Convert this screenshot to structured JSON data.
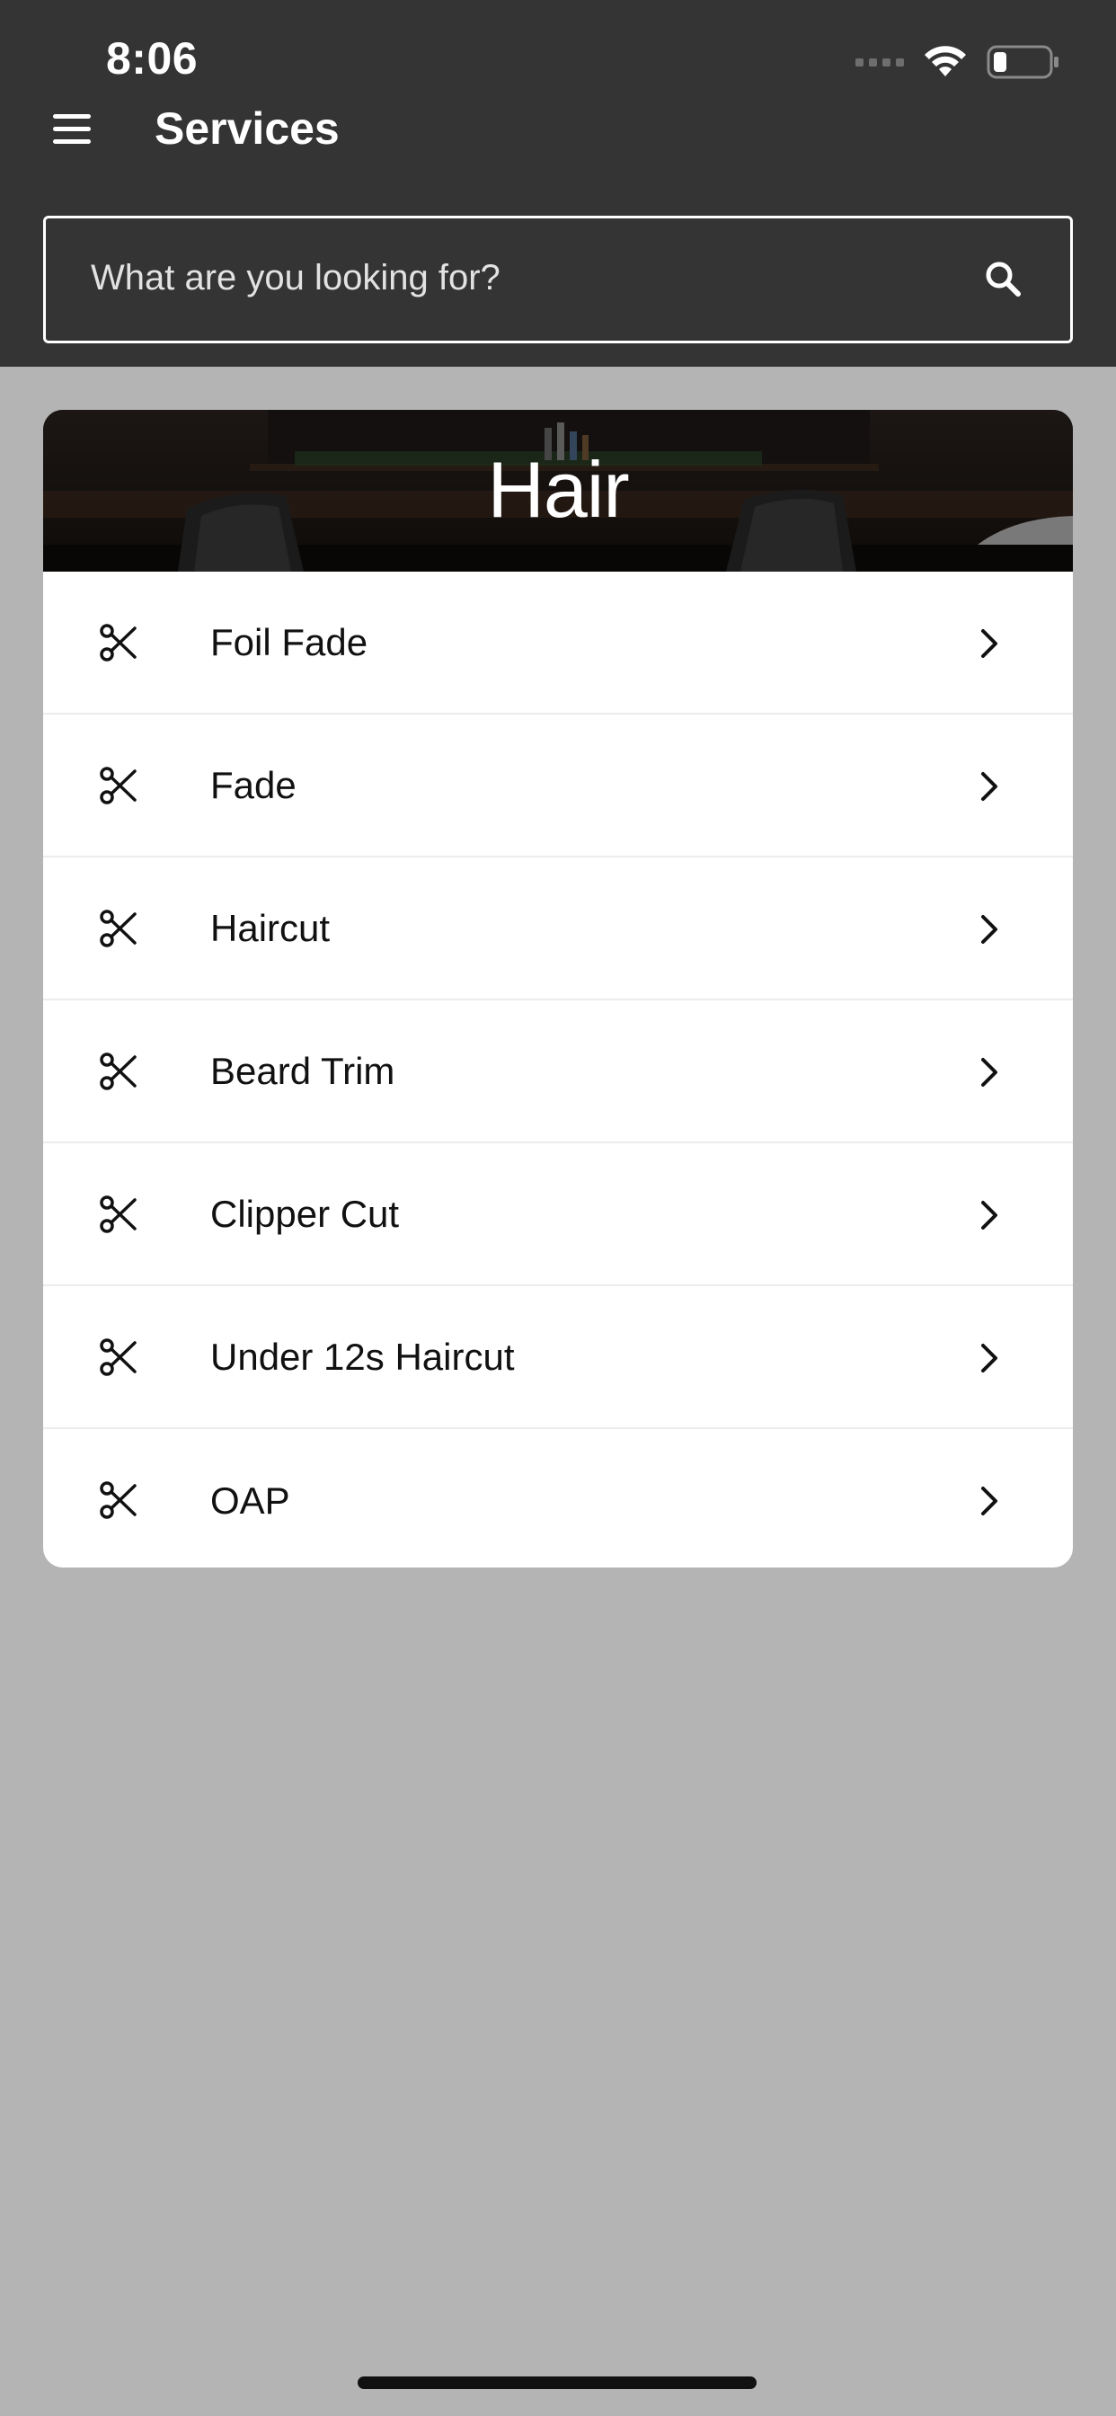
{
  "status_bar": {
    "time": "8:06",
    "icons": [
      "signal-dots-icon",
      "wifi-icon",
      "battery-icon"
    ]
  },
  "header": {
    "menu_icon": "hamburger-menu-icon",
    "title": "Services",
    "background_color": "#343434"
  },
  "search": {
    "placeholder": "What are you looking for?",
    "icon": "search-icon"
  },
  "category": {
    "title": "Hair",
    "banner_image": "barbershop-interior-photo"
  },
  "services": [
    {
      "label": "Foil Fade",
      "icon": "scissors-icon"
    },
    {
      "label": "Fade",
      "icon": "scissors-icon"
    },
    {
      "label": "Haircut",
      "icon": "scissors-icon"
    },
    {
      "label": "Beard Trim",
      "icon": "scissors-icon"
    },
    {
      "label": "Clipper Cut",
      "icon": "scissors-icon"
    },
    {
      "label": "Under 12s Haircut",
      "icon": "scissors-icon"
    },
    {
      "label": "OAP",
      "icon": "scissors-icon"
    }
  ],
  "colors": {
    "page_background": "#b4b4b4",
    "header_background": "#343434",
    "card_background": "#ffffff",
    "text_primary": "#111111"
  }
}
